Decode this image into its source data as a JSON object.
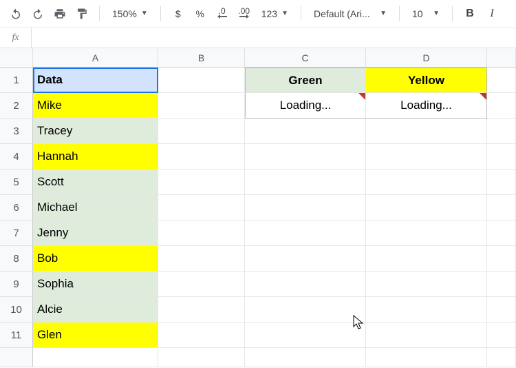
{
  "toolbar": {
    "zoom": "150%",
    "currency": "$",
    "percent": "%",
    "dec_dec": ".0",
    "inc_dec": ".00",
    "format123": "123",
    "font": "Default (Ari...",
    "fontSize": "10",
    "bold": "B",
    "italic": "I"
  },
  "formulaBar": {
    "fx": "fx",
    "value": ""
  },
  "columns": {
    "A": "A",
    "B": "B",
    "C": "C",
    "D": "D"
  },
  "rowNums": [
    "1",
    "2",
    "3",
    "4",
    "5",
    "6",
    "7",
    "8",
    "9",
    "10",
    "11"
  ],
  "cells": {
    "A1": "Data",
    "A2": "Mike",
    "A3": "Tracey",
    "A4": "Hannah",
    "A5": "Scott",
    "A6": "Michael",
    "A7": "Jenny",
    "A8": "Bob",
    "A9": "Sophia",
    "A10": "Alcie",
    "A11": "Glen",
    "C1": "Green",
    "D1": "Yellow",
    "C2": "Loading...",
    "D2": "Loading..."
  },
  "colors": {
    "yellow": "#ffff00",
    "paleGreen": "#dfecdc",
    "headerSelected": "#d3e3fd",
    "selectionBorder": "#1a73e8"
  }
}
